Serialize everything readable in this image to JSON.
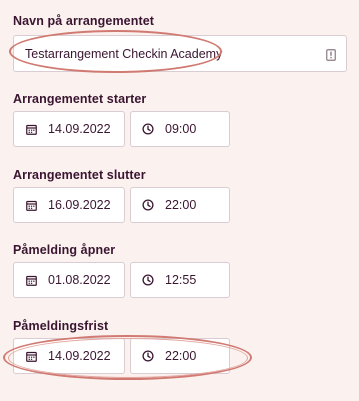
{
  "event_name": {
    "label": "Navn på arrangementet",
    "value": "Testarrangement Checkin Academy",
    "right_icon": "info-badge-icon"
  },
  "event_start": {
    "label": "Arrangementet starter",
    "date": "14.09.2022",
    "time": "09:00"
  },
  "event_end": {
    "label": "Arrangementet slutter",
    "date": "16.09.2022",
    "time": "22:00"
  },
  "registration_opens": {
    "label": "Påmelding åpner",
    "date": "01.08.2022",
    "time": "12:55"
  },
  "registration_deadline": {
    "label": "Påmeldingsfrist",
    "date": "14.09.2022",
    "time": "22:00"
  },
  "icons": {
    "date": "calendar-icon",
    "time": "clock-icon"
  },
  "colors": {
    "background": "#fbf1ef",
    "text": "#3a1530",
    "field_border": "#d9ccd2",
    "highlight_ellipse": "#d07a72"
  }
}
